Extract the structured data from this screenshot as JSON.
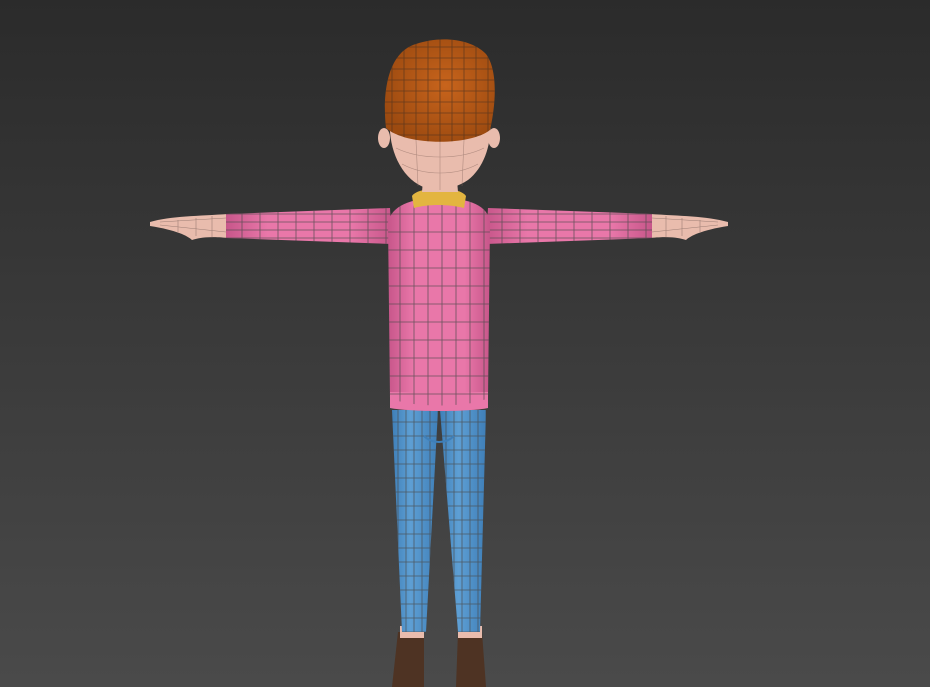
{
  "scene": {
    "view": "back",
    "pose": "t-pose",
    "shading": "smooth-with-wireframe",
    "colors": {
      "background_top": "#2b2b2b",
      "background_bottom": "#4a4a4a",
      "hair": "#9c4a10",
      "hair_highlight": "#c8641c",
      "skin": "#e9bcad",
      "skin_shadow": "#b58d82",
      "collar": "#e3b540",
      "sweater": "#e977a9",
      "sweater_shadow": "#c7568a",
      "jeans": "#5e9fd4",
      "jeans_shadow": "#3f7fb8",
      "boots": "#4e3323",
      "wire": "#4a4a4a"
    }
  }
}
